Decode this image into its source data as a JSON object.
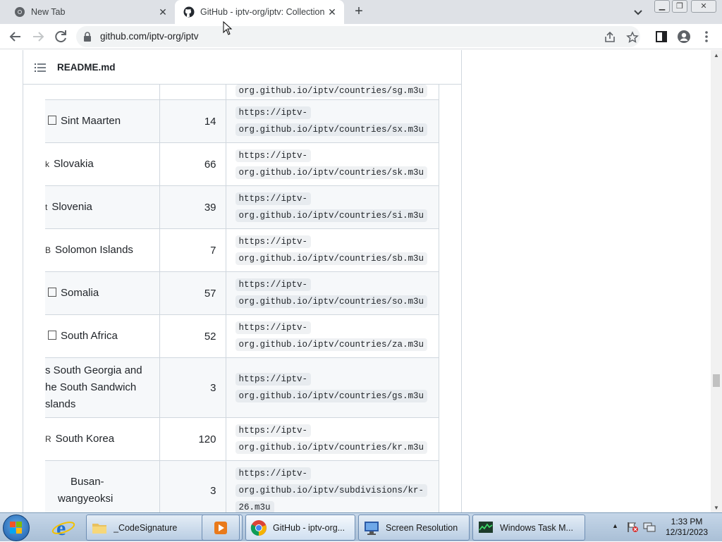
{
  "browser": {
    "tabs": [
      {
        "title": "New Tab",
        "active": false
      },
      {
        "title": "GitHub - iptv-org/iptv: Collection",
        "active": true
      }
    ],
    "new_tab_symbol": "+",
    "url": "github.com/iptv-org/iptv",
    "window_controls": [
      "minimize",
      "restore",
      "close"
    ]
  },
  "readme": {
    "filename": "README.md"
  },
  "rows": [
    {
      "flag": "",
      "country": "",
      "count": "",
      "url": "org.github.io/iptv/countries/sg.m3u",
      "partial": true
    },
    {
      "flag": "",
      "country": "Sint Maarten",
      "count": "14",
      "url": "https://iptv-org.github.io/iptv/countries/sx.m3u",
      "url1": "https://iptv-",
      "url2": "org.github.io/iptv/countries/sx.m3u"
    },
    {
      "flag": "k",
      "country": "Slovakia",
      "count": "66",
      "url1": "https://iptv-",
      "url2": "org.github.io/iptv/countries/sk.m3u"
    },
    {
      "flag": "t",
      "country": "Slovenia",
      "count": "39",
      "url1": "https://iptv-",
      "url2": "org.github.io/iptv/countries/si.m3u"
    },
    {
      "flag": "B",
      "country": "Solomon Islands",
      "count": "7",
      "url1": "https://iptv-",
      "url2": "org.github.io/iptv/countries/sb.m3u"
    },
    {
      "flag": "",
      "country": "Somalia",
      "count": "57",
      "url1": "https://iptv-",
      "url2": "org.github.io/iptv/countries/so.m3u"
    },
    {
      "flag": "",
      "country": "South Africa",
      "count": "52",
      "url1": "https://iptv-",
      "url2": "org.github.io/iptv/countries/za.m3u"
    },
    {
      "flag": "s",
      "country_lines": [
        "s South Georgia and",
        "he South Sandwich",
        "slands"
      ],
      "count": "3",
      "url1": "https://iptv-",
      "url2": "org.github.io/iptv/countries/gs.m3u"
    },
    {
      "flag": "R",
      "country": "South Korea",
      "count": "120",
      "url1": "https://iptv-",
      "url2": "org.github.io/iptv/countries/kr.m3u"
    },
    {
      "flag": "",
      "country_lines": [
        "Busan-",
        "wangyeoksi"
      ],
      "count": "3",
      "url1": "https://iptv-",
      "url2": "org.github.io/iptv/subdivisions/kr-",
      "url3": "26.m3u"
    }
  ],
  "taskbar": {
    "tasks": [
      {
        "label": "_CodeSignature",
        "icon": "folder-icon"
      },
      {
        "label": "",
        "icon": "media-player-icon"
      },
      {
        "label": "GitHub - iptv-org...",
        "icon": "chrome-icon",
        "active": true
      },
      {
        "label": "Screen Resolution",
        "icon": "display-icon"
      },
      {
        "label": "Windows Task M...",
        "icon": "task-manager-icon"
      }
    ],
    "time": "1:33 PM",
    "date": "12/31/2023"
  }
}
